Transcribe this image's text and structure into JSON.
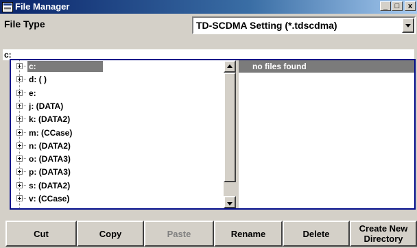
{
  "window": {
    "title": "File Manager",
    "minimize_glyph": "_",
    "maximize_glyph": "□",
    "close_glyph": "x"
  },
  "file_type": {
    "label": "File Type",
    "selected": "TD-SCDMA Setting (*.tdscdma)"
  },
  "current_path": "c:",
  "drives": [
    {
      "label": "c:",
      "selected": true
    },
    {
      "label": "d: ( )",
      "selected": false
    },
    {
      "label": "e:",
      "selected": false
    },
    {
      "label": "j: (DATA)",
      "selected": false
    },
    {
      "label": "k: (DATA2)",
      "selected": false
    },
    {
      "label": "m: (CCase)",
      "selected": false
    },
    {
      "label": "n: (DATA2)",
      "selected": false
    },
    {
      "label": "o: (DATA3)",
      "selected": false
    },
    {
      "label": "p: (DATA3)",
      "selected": false
    },
    {
      "label": "s: (DATA2)",
      "selected": false
    },
    {
      "label": "v: (CCase)",
      "selected": false
    }
  ],
  "files": {
    "message": "no files found"
  },
  "buttons": {
    "cut": "Cut",
    "copy": "Copy",
    "paste": "Paste",
    "rename": "Rename",
    "delete": "Delete",
    "create_new_line1": "Create New",
    "create_new_line2": "Directory"
  },
  "colors": {
    "title_bar": "#0a246a",
    "selection": "#7b7b7b",
    "panel_border": "#000b8a",
    "face": "#d4d0c8"
  },
  "icons": {
    "app": "file-manager-icon",
    "expander": "plus-expander-icon",
    "scroll_up": "triangle-up-icon",
    "scroll_down": "triangle-down-icon",
    "dropdown": "triangle-down-icon"
  }
}
